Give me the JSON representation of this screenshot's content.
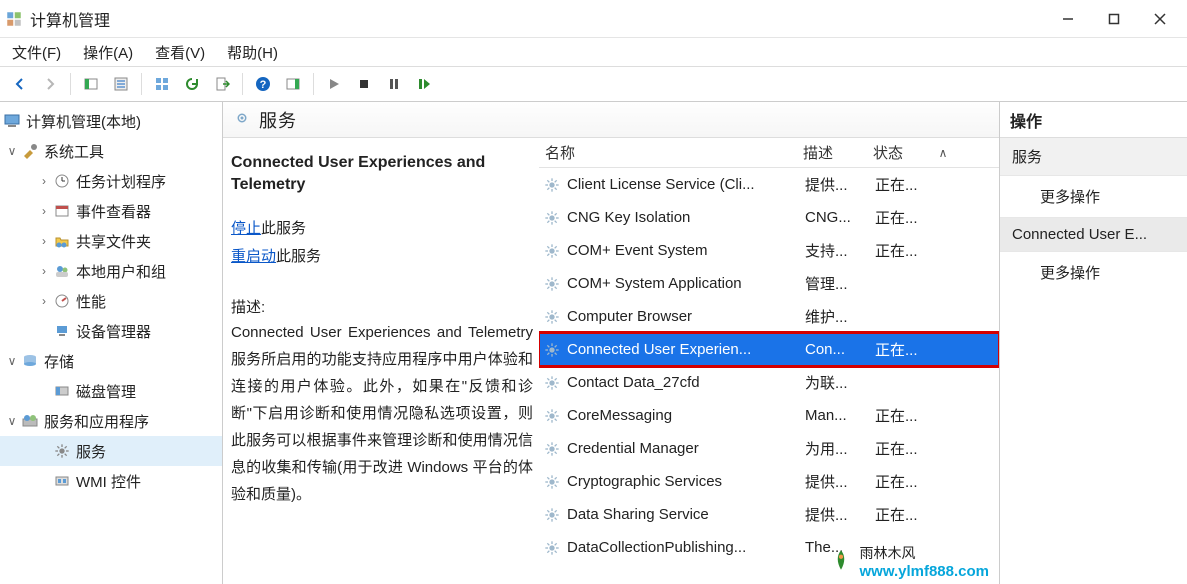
{
  "titlebar": {
    "title": "计算机管理"
  },
  "menus": [
    "文件(F)",
    "操作(A)",
    "查看(V)",
    "帮助(H)"
  ],
  "tree": {
    "root": "计算机管理(本地)",
    "sys_tools": "系统工具",
    "task_scheduler": "任务计划程序",
    "event_viewer": "事件查看器",
    "shared_folders": "共享文件夹",
    "local_users": "本地用户和组",
    "performance": "性能",
    "device_manager": "设备管理器",
    "storage": "存储",
    "disk_mgmt": "磁盘管理",
    "services_apps": "服务和应用程序",
    "services": "服务",
    "wmi": "WMI 控件"
  },
  "center": {
    "header": "服务",
    "detail_title": "Connected User Experiences and Telemetry",
    "stop_label": "停止",
    "stop_suffix": "此服务",
    "restart_label": "重启动",
    "restart_suffix": "此服务",
    "desc_label": "描述:",
    "description": "Connected User Experiences and Telemetry 服务所启用的功能支持应用程序中用户体验和连接的用户体验。此外，如果在\"反馈和诊断\"下启用诊断和使用情况隐私选项设置，则此服务可以根据事件来管理诊断和使用情况信息的收集和传输(用于改进 Windows 平台的体验和质量)。"
  },
  "columns": {
    "name": "名称",
    "desc": "描述",
    "state": "状态"
  },
  "services_list": [
    {
      "name": "Client License Service (Cli...",
      "desc": "提供...",
      "state": "正在..."
    },
    {
      "name": "CNG Key Isolation",
      "desc": "CNG...",
      "state": "正在..."
    },
    {
      "name": "COM+ Event System",
      "desc": "支持...",
      "state": "正在..."
    },
    {
      "name": "COM+ System Application",
      "desc": "管理...",
      "state": ""
    },
    {
      "name": "Computer Browser",
      "desc": "维护...",
      "state": ""
    },
    {
      "name": "Connected User Experien...",
      "desc": "Con...",
      "state": "正在...",
      "highlight": true
    },
    {
      "name": "Contact Data_27cfd",
      "desc": "为联...",
      "state": ""
    },
    {
      "name": "CoreMessaging",
      "desc": "Man...",
      "state": "正在..."
    },
    {
      "name": "Credential Manager",
      "desc": "为用...",
      "state": "正在..."
    },
    {
      "name": "Cryptographic Services",
      "desc": "提供...",
      "state": "正在..."
    },
    {
      "name": "Data Sharing Service",
      "desc": "提供...",
      "state": "正在..."
    },
    {
      "name": "DataCollectionPublishing...",
      "desc": "The...",
      "state": ""
    }
  ],
  "right": {
    "header": "操作",
    "group1": "服务",
    "more_actions": "更多操作",
    "selected": "Connected User E..."
  },
  "watermark": {
    "brand": "雨林木风",
    "url": "www.ylmf888.com"
  }
}
